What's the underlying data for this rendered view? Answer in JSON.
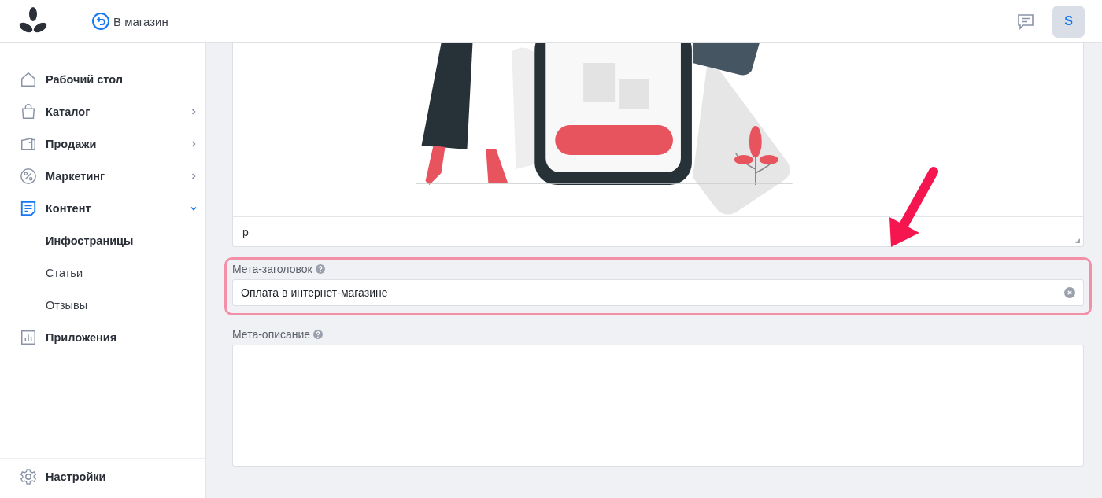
{
  "header": {
    "store_link": "В магазин",
    "avatar": "S"
  },
  "sidebar": {
    "items": [
      {
        "label": "Рабочий стол",
        "kind": "link",
        "selected": false
      },
      {
        "label": "Каталог",
        "kind": "group",
        "selected": false,
        "expanded": false
      },
      {
        "label": "Продажи",
        "kind": "group",
        "selected": false,
        "expanded": false
      },
      {
        "label": "Маркетинг",
        "kind": "group",
        "selected": false,
        "expanded": false
      },
      {
        "label": "Контент",
        "kind": "group",
        "selected": true,
        "expanded": true,
        "children": [
          {
            "label": "Инфостраницы",
            "selected": true
          },
          {
            "label": "Статьи",
            "selected": false
          },
          {
            "label": "Отзывы",
            "selected": false
          }
        ]
      },
      {
        "label": "Приложения",
        "kind": "link",
        "selected": false
      }
    ],
    "footer_item": {
      "label": "Настройки"
    }
  },
  "editor": {
    "text": "p"
  },
  "meta_title": {
    "label": "Мета-заголовок",
    "value": "Оплата в интернет-магазине"
  },
  "meta_description": {
    "label": "Мета-описание"
  }
}
